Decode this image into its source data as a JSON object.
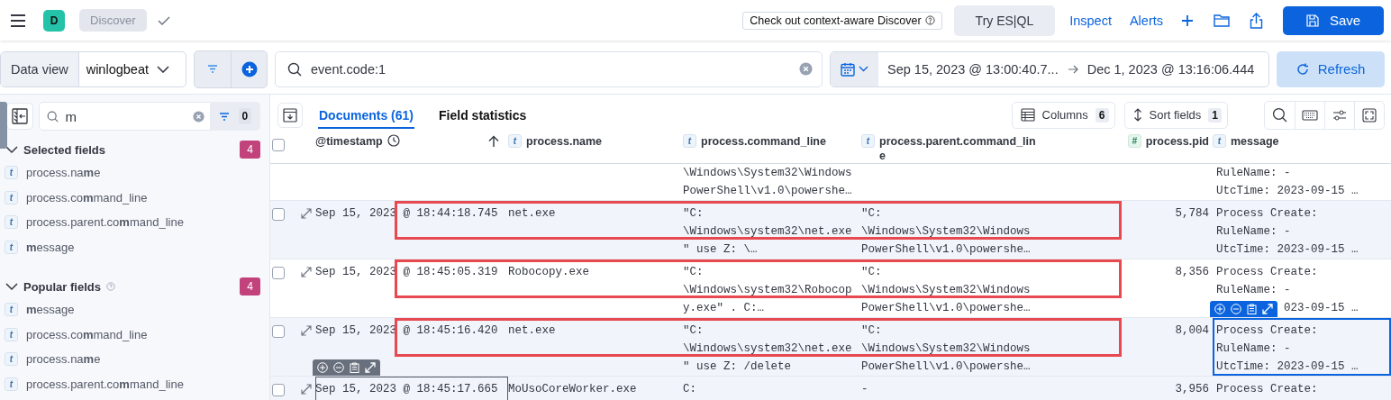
{
  "top_bar": {
    "avatar": "D",
    "breadcrumb": "Discover",
    "promo": "Check out context-aware Discover",
    "esql": "Try ES|QL",
    "links": [
      "Inspect",
      "Alerts"
    ],
    "save": "Save"
  },
  "query_bar": {
    "data_view_label": "Data view",
    "data_view": "winlogbeat",
    "query": "event.code:1",
    "start": "Sep 15, 2023 @ 13:00:40.7...",
    "end": "Dec 1, 2023 @ 13:16:06.444",
    "refresh": "Refresh"
  },
  "sidebar": {
    "search": "m",
    "filter_count": "0",
    "sections": [
      {
        "title": "Selected fields",
        "count": "4",
        "help": false,
        "expanded": true,
        "fields": [
          {
            "type": "t",
            "name": "process.na**m**e"
          },
          {
            "type": "t",
            "name": "process.co**m**mand_line"
          },
          {
            "type": "t",
            "name": "process.parent.co**m**mand_line"
          },
          {
            "type": "t",
            "name": "**m**essage"
          }
        ]
      },
      {
        "title": "Popular fields",
        "count": "4",
        "help": true,
        "expanded": true,
        "fields": [
          {
            "type": "t",
            "name": "**m**essage"
          },
          {
            "type": "t",
            "name": "process.co**m**mand_line"
          },
          {
            "type": "t",
            "name": "process.na**m**e"
          },
          {
            "type": "t",
            "name": "process.parent.co**m**mand_line"
          }
        ]
      }
    ]
  },
  "tabs": [
    {
      "label": "Documents (61)",
      "selected": true
    },
    {
      "label": "Field statistics",
      "selected": false
    }
  ],
  "toolbar": {
    "columns": {
      "label": "Columns",
      "count": "6"
    },
    "sort": {
      "label": "Sort fields",
      "count": "1"
    }
  },
  "table": {
    "all_checked": false,
    "columns": [
      {
        "kind": "timestamp",
        "label": "@timestamp",
        "sorted": true
      },
      {
        "kind": "field",
        "type": "t",
        "label": "process.name",
        "sorted": false
      },
      {
        "kind": "field",
        "type": "t",
        "label": "process.command_line",
        "sorted": false
      },
      {
        "kind": "field",
        "type": "t",
        "label": "process.parent.command_line",
        "sorted": false
      },
      {
        "kind": "number",
        "type": "#",
        "label": "process.pid",
        "sorted": false
      },
      {
        "kind": "field",
        "type": "t",
        "label": "message",
        "sorted": false
      }
    ],
    "rows": [
      {
        "partial": true,
        "cells": {
          "command_line": {
            "kind": "plain",
            "lines": [
              "\\Windows\\System32\\Windows",
              "PowerShell\\v1.0\\powershe…"
            ]
          },
          "message": {
            "kind": "plain",
            "lines": [
              "RuleName: -",
              "UtcTime: 2023-09-15 …"
            ]
          }
        }
      },
      {
        "partial": false,
        "checked": false,
        "annotated": true,
        "cells": {
          "timestamp": {
            "kind": "plain",
            "lines": [
              "Sep 15, 2023 @ 18:44:18.745"
            ]
          },
          "process_name": {
            "kind": "plain",
            "lines": [
              "net.exe"
            ]
          },
          "command_line": {
            "kind": "plain",
            "lines": [
              "\"C:",
              "\\Windows\\system32\\net.exe",
              "\" use Z: \\…"
            ]
          },
          "parent_command_line": {
            "kind": "plain",
            "lines": [
              "\"C:",
              "\\Windows\\System32\\Windows",
              "PowerShell\\v1.0\\powershe…"
            ]
          },
          "pid": {
            "kind": "plain",
            "lines": [
              "5,784"
            ]
          },
          "message": {
            "kind": "plain",
            "lines": [
              "Process Create:",
              "RuleName: -",
              "UtcTime: 2023-09-15 …"
            ]
          }
        }
      },
      {
        "partial": false,
        "checked": false,
        "annotated": true,
        "cells": {
          "timestamp": {
            "kind": "plain",
            "lines": [
              "Sep 15, 2023 @ 18:45:05.319"
            ]
          },
          "process_name": {
            "kind": "plain",
            "lines": [
              "Robocopy.exe"
            ]
          },
          "command_line": {
            "kind": "plain",
            "lines": [
              "\"C:",
              "\\Windows\\system32\\Robocop",
              "y.exe\" . C:…"
            ]
          },
          "parent_command_line": {
            "kind": "plain",
            "lines": [
              "\"C:",
              "\\Windows\\System32\\Windows",
              "PowerShell\\v1.0\\powershe…"
            ]
          },
          "pid": {
            "kind": "plain",
            "lines": [
              "8,356"
            ]
          },
          "message": {
            "kind": "covered",
            "lines": [
              "Process Create:",
              "RuleName: -",
              "023-09-15 …"
            ]
          }
        }
      },
      {
        "partial": false,
        "checked": false,
        "annotated": true,
        "cells": {
          "timestamp": {
            "kind": "plain",
            "lines": [
              "Sep 15, 2023 @ 18:45:16.420"
            ]
          },
          "process_name": {
            "kind": "plain",
            "lines": [
              "net.exe"
            ]
          },
          "command_line": {
            "kind": "plain",
            "lines": [
              "\"C:",
              "\\Windows\\system32\\net.exe",
              "\" use Z: /delete"
            ]
          },
          "parent_command_line": {
            "kind": "plain",
            "lines": [
              "\"C:",
              "\\Windows\\System32\\Windows",
              "PowerShell\\v1.0\\powershe…"
            ]
          },
          "pid": {
            "kind": "plain",
            "lines": [
              "8,004"
            ]
          },
          "message": {
            "kind": "focused",
            "lines": [
              "Process Create:",
              "RuleName: -",
              "UtcTime: 2023-09-15 …"
            ]
          }
        }
      },
      {
        "partial": false,
        "checked": false,
        "cells": {
          "timestamp": {
            "kind": "hovered",
            "lines": [
              "Sep 15, 2023 @ 18:45:17.665"
            ]
          },
          "process_name": {
            "kind": "plain",
            "lines": [
              "MoUsoCoreWorker.exe"
            ]
          },
          "command_line": {
            "kind": "plain",
            "lines": [
              "C:"
            ]
          },
          "parent_command_line": {
            "kind": "plain",
            "lines": [
              "-"
            ]
          },
          "pid": {
            "kind": "plain",
            "lines": [
              "3,956"
            ]
          },
          "message": {
            "kind": "plain",
            "lines": [
              "Process Create:"
            ]
          }
        }
      }
    ]
  }
}
